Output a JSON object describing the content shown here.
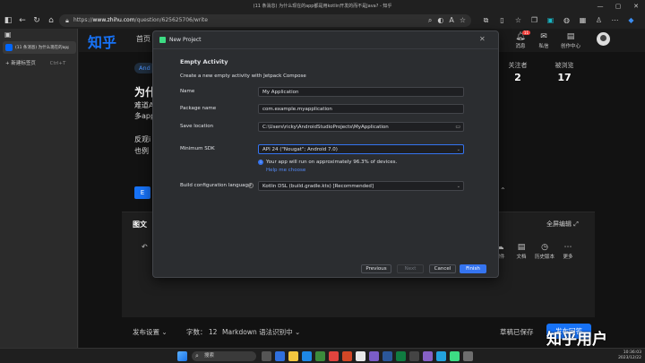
{
  "browser": {
    "window_title": "(11 条消息) 为什么现在的app都是用kotlin开发的而不是Java? - 知乎",
    "url_prefix": "https://",
    "url_domain": "www.zhihu.com",
    "url_path": "/question/625625706/write",
    "tab_title": "(11 条消息) 为什么现在的app都...",
    "new_tab_label": "新建标签页",
    "new_tab_shortcut": "Ctrl+T"
  },
  "zhihu": {
    "logo": "知乎",
    "home": "首页",
    "header": {
      "messages_label": "消息",
      "messages_badge": "11",
      "inbox_label": "私信",
      "creator_label": "创作中心"
    },
    "question": {
      "tag": "And",
      "title": "为什",
      "lines": [
        "难道A",
        "多app",
        "反观i",
        "也例"
      ]
    },
    "stats": [
      {
        "label": "关注者",
        "value": "2"
      },
      {
        "label": "被浏览",
        "value": "17"
      }
    ],
    "editor": {
      "tab_title": "图文",
      "fullscreen": "全屏编辑",
      "tools": [
        {
          "label": "附件"
        },
        {
          "label": "文档"
        },
        {
          "label": "历史版本"
        },
        {
          "label": "更多"
        }
      ],
      "left_tool_label": "撤"
    },
    "footer": {
      "publish_settings": "发布设置",
      "word_count_label": "字数：",
      "word_count": "12",
      "markdown_status": "Markdown 语法识别中",
      "draft_saved": "草稿已保存",
      "publish": "发布回答"
    }
  },
  "dialog": {
    "title": "New Project",
    "heading": "Empty Activity",
    "subtitle": "Create a new empty activity with Jetpack Compose",
    "fields": {
      "name_label": "Name",
      "name_value": "My Application",
      "package_label": "Package name",
      "package_value": "com.example.myapplication",
      "save_label": "Save location",
      "save_value": "C:\\Users\\ricky\\AndroidStudioProjects\\MyApplication",
      "min_sdk_label": "Minimum SDK",
      "min_sdk_value": "API 24 (\"Nougat\"; Android 7.0)",
      "sdk_info": "Your app will run on approximately 96.3% of devices.",
      "help_link": "Help me choose",
      "build_label": "Build configuration language",
      "build_value": "Kotlin DSL (build.gradle.kts) [Recommended]"
    },
    "buttons": {
      "previous": "Previous",
      "next": "Next",
      "cancel": "Cancel",
      "finish": "Finish"
    }
  },
  "watermark": "知乎用户",
  "taskbar": {
    "search": "搜索",
    "time": "10:36:03",
    "date": "2023/12/22"
  },
  "colors": {
    "zhihu_blue": "#1772f6",
    "android_green": "#3ddc84",
    "primary_button": "#3574f0",
    "dialog_bg": "#2b2d30"
  }
}
